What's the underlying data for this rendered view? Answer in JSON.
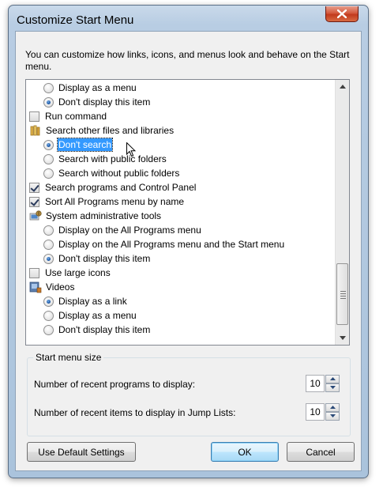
{
  "window": {
    "title": "Customize Start Menu"
  },
  "description": "You can customize how links, icons, and menus look and behave on the Start menu.",
  "options": [
    {
      "kind": "radio",
      "indent": 1,
      "label": "Display as a menu",
      "checked": false
    },
    {
      "kind": "radio",
      "indent": 1,
      "label": "Don't display this item",
      "checked": true
    },
    {
      "kind": "checkbox",
      "indent": 0,
      "label": "Run command",
      "checked": false
    },
    {
      "kind": "group",
      "indent": 0,
      "label": "Search other files and libraries",
      "icon": "folder-library-icon"
    },
    {
      "kind": "radio",
      "indent": 1,
      "label": "Don't search",
      "checked": true,
      "selected": true
    },
    {
      "kind": "radio",
      "indent": 1,
      "label": "Search with public folders",
      "checked": false
    },
    {
      "kind": "radio",
      "indent": 1,
      "label": "Search without public folders",
      "checked": false
    },
    {
      "kind": "checkbox",
      "indent": 0,
      "label": "Search programs and Control Panel",
      "checked": true
    },
    {
      "kind": "checkbox",
      "indent": 0,
      "label": "Sort All Programs menu by name",
      "checked": true
    },
    {
      "kind": "group",
      "indent": 0,
      "label": "System administrative tools",
      "icon": "admin-tools-icon"
    },
    {
      "kind": "radio",
      "indent": 1,
      "label": "Display on the All Programs menu",
      "checked": false
    },
    {
      "kind": "radio",
      "indent": 1,
      "label": "Display on the All Programs menu and the Start menu",
      "checked": false
    },
    {
      "kind": "radio",
      "indent": 1,
      "label": "Don't display this item",
      "checked": true
    },
    {
      "kind": "checkbox",
      "indent": 0,
      "label": "Use large icons",
      "checked": false
    },
    {
      "kind": "group",
      "indent": 0,
      "label": "Videos",
      "icon": "videos-icon"
    },
    {
      "kind": "radio",
      "indent": 1,
      "label": "Display as a link",
      "checked": true
    },
    {
      "kind": "radio",
      "indent": 1,
      "label": "Display as a menu",
      "checked": false
    },
    {
      "kind": "radio",
      "indent": 1,
      "label": "Don't display this item",
      "checked": false
    }
  ],
  "start_menu_size": {
    "title": "Start menu size",
    "recent_programs_label": "Number of recent programs to display:",
    "recent_programs_value": "10",
    "recent_items_label": "Number of recent items to display in Jump Lists:",
    "recent_items_value": "10"
  },
  "buttons": {
    "defaults": "Use Default Settings",
    "ok": "OK",
    "cancel": "Cancel"
  },
  "colors": {
    "selection": "#3399ff",
    "close_button": "#c23a1d"
  }
}
